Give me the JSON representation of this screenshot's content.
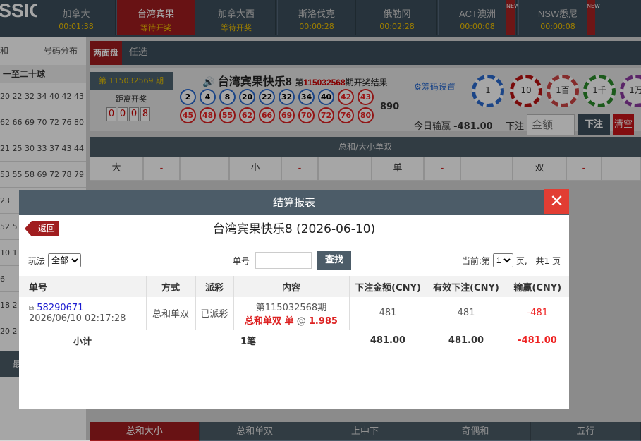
{
  "topbar": {
    "logo": "SSIC",
    "games": [
      {
        "name": "加拿大",
        "status": "00:01:38",
        "new": false
      },
      {
        "name": "台湾宾果",
        "status": "等待开奖",
        "new": false,
        "active": true
      },
      {
        "name": "加拿大西",
        "status": "等待开奖",
        "new": false
      },
      {
        "name": "斯洛伐克",
        "status": "00:00:28",
        "new": false
      },
      {
        "name": "俄勒冈",
        "status": "00:02:28",
        "new": false
      },
      {
        "name": "ACT澳洲",
        "status": "00:00:08",
        "new": true
      },
      {
        "name": "NSW悉尼",
        "status": "00:00:08",
        "new": true
      }
    ],
    "new_tag": "NEW"
  },
  "left": {
    "tab_a": "和",
    "tab_b": "号码分布",
    "sub": "一至二十球",
    "rows": [
      "20 22 32 34 40 42 43",
      "62 66 69 70 72 76 80",
      "21 25 30 33 37 43 44",
      "53 55 58 69 72 78 79",
      "23",
      "52 5",
      "10 1",
      "6",
      "18 2",
      "20 2"
    ],
    "box_label": "最"
  },
  "main": {
    "tabs": [
      "两面盘",
      "任选"
    ],
    "issue": "第 115032569 期",
    "countdown_label": "距离开奖",
    "countdown": [
      "0",
      "0",
      "0",
      "8"
    ],
    "game_title": "台湾宾果快乐8",
    "result_prefix": "第",
    "result_issue": "115032568",
    "result_suffix": "期开奖结果",
    "balls": [
      "2",
      "4",
      "8",
      "20",
      "22",
      "32",
      "34",
      "40",
      "42",
      "43",
      "45",
      "48",
      "55",
      "62",
      "66",
      "69",
      "70",
      "72",
      "76",
      "80"
    ],
    "sum": "890",
    "chip_setting": "筹码设置",
    "chips": [
      "1",
      "10",
      "1百",
      "1千",
      "1万"
    ],
    "today_label": "今日输赢",
    "today_value": "-481.00",
    "bet_label": "下注",
    "bet_placeholder": "金额",
    "bet_button": "下注",
    "clear_button": "清空",
    "section_title": "总和/大小单双",
    "odds_row": [
      {
        "label": "大",
        "odd": "-"
      },
      {
        "label": "小",
        "odd": "-"
      },
      {
        "label": "单",
        "odd": "-"
      },
      {
        "label": "双",
        "odd": "-"
      }
    ],
    "bottom_tabs": [
      "总和大小",
      "总和单双",
      "上中下",
      "奇偶和",
      "五行"
    ]
  },
  "modal": {
    "header": "结算报表",
    "close": "✕",
    "back": "返回",
    "title": "台湾宾果快乐8 (2026-06-10)",
    "filter_play_label": "玩法",
    "filter_play_value": "全部",
    "filter_no_label": "单号",
    "search_button": "查找",
    "page_prefix": "当前:第",
    "page_value": "1",
    "page_suffix": "页,",
    "page_total": "共1 页",
    "columns": [
      "单号",
      "方式",
      "派彩",
      "内容",
      "下注金额(CNY)",
      "有效下注(CNY)",
      "输赢(CNY)"
    ],
    "row": {
      "order_no": "58290671",
      "datetime": "2026/06/10 02:17:28",
      "method": "总和单双",
      "payout": "已派彩",
      "issue": "第115032568期",
      "content_main": "总和单双 单",
      "at": "@",
      "odds": "1.985",
      "bet_amount": "481",
      "valid_bet": "481",
      "win_loss": "-481"
    },
    "subtotal": {
      "label": "小计",
      "count": "1笔",
      "bet_amount": "481.00",
      "valid_bet": "481.00",
      "win_loss": "-481.00"
    }
  },
  "colors": {
    "brand_red": "#a01d1f",
    "header_slate": "#4c5c68",
    "loss_red": "#e22"
  }
}
